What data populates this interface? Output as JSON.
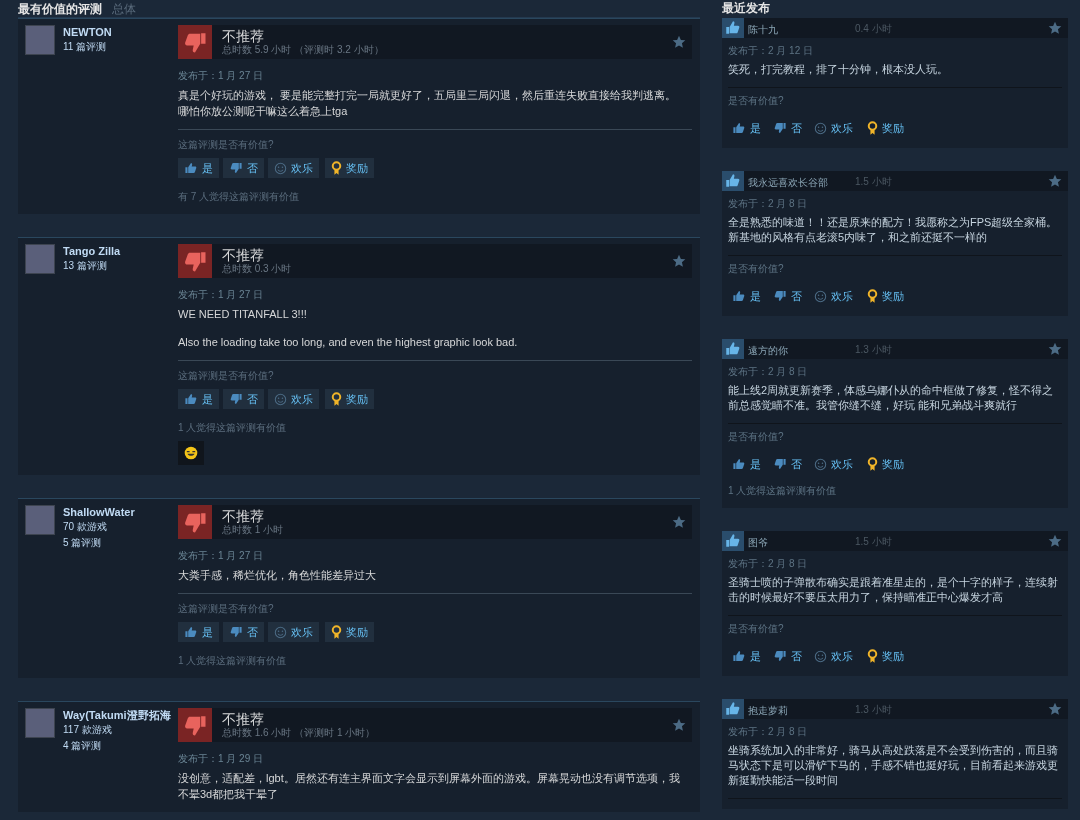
{
  "tabs": [
    {
      "label": "最有价值的评测",
      "selected": true
    },
    {
      "label": "总体",
      "selected": false
    }
  ],
  "recent_heading": "最近发布",
  "helpful_reviews": [
    {
      "author": "NEWTON",
      "stats": [
        "11 篇评测"
      ],
      "verdict": "不推荐",
      "recommended": false,
      "playtime": "总时数 5.9 小时 （评测时 3.2 小时）",
      "date": "发布于：1 月 27 日",
      "paragraphs": [
        "真是个好玩的游戏， 要是能完整打完一局就更好了，五局里三局闪退，然后重连失败直接给我判逃离。哪怕你放公测呢干嘛这么着急上tga"
      ],
      "question": "这篇评测是否有价值?",
      "votes": [
        {
          "kind": "up",
          "label": "是"
        },
        {
          "kind": "down",
          "label": "否"
        },
        {
          "kind": "funny",
          "label": "欢乐"
        },
        {
          "kind": "award",
          "label": "奖励"
        }
      ],
      "helpful_count": "有 7 人觉得这篇评测有价值",
      "has_award": false
    },
    {
      "author": "Tango Zilla",
      "stats": [
        "13 篇评测"
      ],
      "verdict": "不推荐",
      "recommended": false,
      "playtime": "总时数 0.3 小时",
      "date": "发布于：1 月 27 日",
      "paragraphs": [
        "WE NEED TITANFALL 3!!!",
        "Also the loading take too long, and even the highest graphic look bad."
      ],
      "question": "这篇评测是否有价值?",
      "votes": [
        {
          "kind": "up",
          "label": "是"
        },
        {
          "kind": "down",
          "label": "否"
        },
        {
          "kind": "funny",
          "label": "欢乐"
        },
        {
          "kind": "award",
          "label": "奖励"
        }
      ],
      "helpful_count": "1 人觉得这篇评测有价值",
      "has_award": true
    },
    {
      "author": "ShallowWater",
      "stats": [
        "70 款游戏",
        "5 篇评测"
      ],
      "verdict": "不推荐",
      "recommended": false,
      "playtime": "总时数 1 小时",
      "date": "发布于：1 月 27 日",
      "paragraphs": [
        "大粪手感，稀烂优化，角色性能差异过大"
      ],
      "question": "这篇评测是否有价值?",
      "votes": [
        {
          "kind": "up",
          "label": "是"
        },
        {
          "kind": "down",
          "label": "否"
        },
        {
          "kind": "funny",
          "label": "欢乐"
        },
        {
          "kind": "award",
          "label": "奖励"
        }
      ],
      "helpful_count": "1 人觉得这篇评测有价值",
      "has_award": false
    },
    {
      "author": "Way(Takumi澄野拓海",
      "stats": [
        "117 款游戏",
        "4 篇评测"
      ],
      "verdict": "不推荐",
      "recommended": false,
      "playtime": "总时数 1.6 小时 （评测时 1 小时）",
      "date": "发布于：1 月 29 日",
      "paragraphs": [
        "没创意，适配差，lgbt。居然还有连主界面文字会显示到屏幕外面的游戏。屏幕晃动也没有调节选项，我不晕3d都把我干晕了"
      ],
      "has_award": false
    }
  ],
  "recent_reviews": [
    {
      "author": "陈十九",
      "recommended": true,
      "playtime": "0.4 小时",
      "date": "发布于：2 月 12 日",
      "text": "笑死，打完教程，排了十分钟，根本没人玩。",
      "question": "是否有价值?",
      "votes": [
        {
          "kind": "up",
          "label": "是"
        },
        {
          "kind": "down",
          "label": "否"
        },
        {
          "kind": "funny",
          "label": "欢乐"
        },
        {
          "kind": "award",
          "label": "奖励"
        }
      ]
    },
    {
      "author": "我永远喜欢长谷部",
      "recommended": true,
      "playtime": "1.5 小时",
      "date": "发布于：2 月 8 日",
      "text": "全是熟悉的味道！！还是原来的配方！我愿称之为FPS超级全家桶。新基地的风格有点老滚5内味了，和之前还挺不一样的",
      "question": "是否有价值?",
      "votes": [
        {
          "kind": "up",
          "label": "是"
        },
        {
          "kind": "down",
          "label": "否"
        },
        {
          "kind": "funny",
          "label": "欢乐"
        },
        {
          "kind": "award",
          "label": "奖励"
        }
      ]
    },
    {
      "author": "遠方的你",
      "recommended": true,
      "playtime": "1.3 小时",
      "date": "发布于：2 月 8 日",
      "text": "能上线2周就更新赛季，体感乌娜仆从的命中框做了修复，怪不得之前总感觉瞄不准。我管你缝不缝，好玩 能和兄弟战斗爽就行",
      "question": "是否有价值?",
      "votes": [
        {
          "kind": "up",
          "label": "是"
        },
        {
          "kind": "down",
          "label": "否"
        },
        {
          "kind": "funny",
          "label": "欢乐"
        },
        {
          "kind": "award",
          "label": "奖励"
        }
      ],
      "helpful_count": "1 人觉得这篇评测有价值"
    },
    {
      "author": "图爷",
      "recommended": true,
      "playtime": "1.5 小时",
      "date": "发布于：2 月 8 日",
      "text": "圣骑士喷的子弹散布确实是跟着准星走的，是个十字的样子，连续射击的时候最好不要压太用力了，保持瞄准正中心爆发才高",
      "question": "是否有价值?",
      "votes": [
        {
          "kind": "up",
          "label": "是"
        },
        {
          "kind": "down",
          "label": "否"
        },
        {
          "kind": "funny",
          "label": "欢乐"
        },
        {
          "kind": "award",
          "label": "奖励"
        }
      ]
    },
    {
      "author": "抱走萝莉",
      "recommended": true,
      "playtime": "1.3 小时",
      "date": "发布于：2 月 8 日",
      "text": "坐骑系统加入的非常好，骑马从高处跌落是不会受到伤害的，而且骑马状态下是可以滑铲下马的，手感不错也挺好玩，目前看起来游戏更新挺勤快能活一段时间"
    }
  ]
}
